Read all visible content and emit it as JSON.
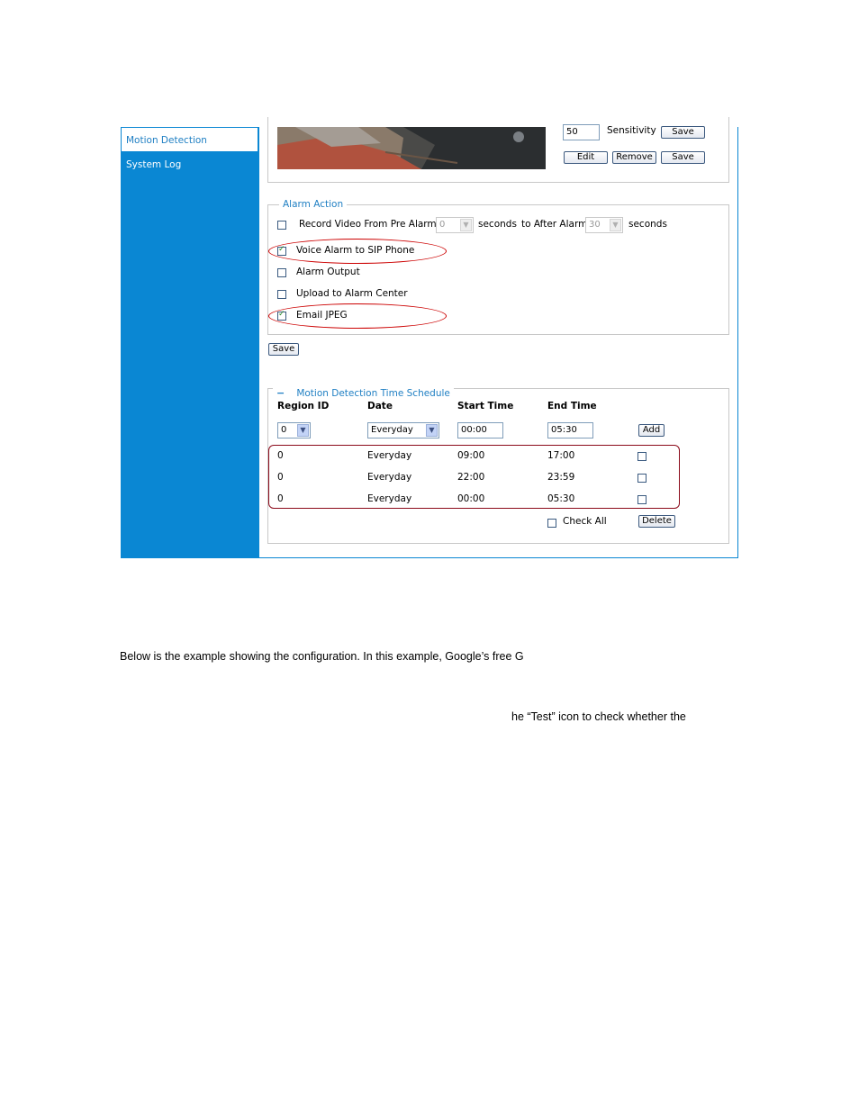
{
  "sidebar": {
    "items": [
      {
        "label": "Motion Detection"
      },
      {
        "label": "System Log"
      }
    ]
  },
  "top_controls": {
    "sensitivity_value": "50",
    "sensitivity_label": "Sensitivity",
    "save_label": "Save",
    "edit_label": "Edit",
    "remove_label": "Remove",
    "save2_label": "Save"
  },
  "alarm_action": {
    "legend": "Alarm Action",
    "record_label": "Record Video From Pre Alarm",
    "pre_alarm_value": "0",
    "seconds_label": "seconds",
    "to_after_label": "to After Alarm",
    "after_alarm_value": "30",
    "seconds2_label": "seconds",
    "options": [
      {
        "label": "Voice Alarm to SIP Phone",
        "checked": true
      },
      {
        "label": "Alarm Output",
        "checked": false
      },
      {
        "label": "Upload to Alarm Center",
        "checked": false
      },
      {
        "label": "Email JPEG",
        "checked": true
      }
    ],
    "save_label": "Save"
  },
  "schedule": {
    "legend": "Motion Detection Time Schedule",
    "collapse_symbol": "−",
    "headers": [
      "Region ID",
      "Date",
      "Start Time",
      "End Time"
    ],
    "new_entry": {
      "region": "0",
      "date": "Everyday",
      "start": "00:00",
      "end": "05:30"
    },
    "add_label": "Add",
    "rows": [
      {
        "region": "0",
        "date": "Everyday",
        "start": "09:00",
        "end": "17:00"
      },
      {
        "region": "0",
        "date": "Everyday",
        "start": "22:00",
        "end": "23:59"
      },
      {
        "region": "0",
        "date": "Everyday",
        "start": "00:00",
        "end": "05:30"
      }
    ],
    "check_all_label": "Check All",
    "delete_label": "Delete"
  },
  "document": {
    "line1": "Below is the example showing the configuration. In this example, Google’s free G",
    "line2": "he “Test” icon to check whether the"
  },
  "colors": {
    "sidebar": "#0a87d3",
    "legend_text": "#1f7fc3",
    "highlight": "#cc0000",
    "table_highlight": "#8b0a1a"
  }
}
